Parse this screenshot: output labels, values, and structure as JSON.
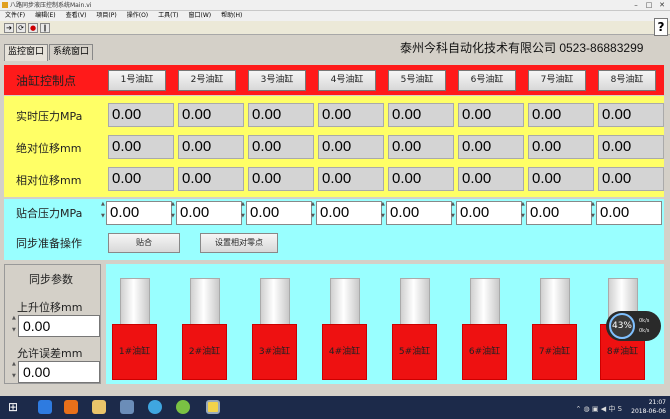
{
  "window": {
    "title": "八路同步液压控制系统Main.vi"
  },
  "menu": [
    "文件(F)",
    "编辑(E)",
    "查看(V)",
    "项目(P)",
    "操作(O)",
    "工具(T)",
    "窗口(W)",
    "帮助(H)"
  ],
  "tabs": [
    {
      "label": "监控窗口",
      "active": true
    },
    {
      "label": "系统窗口",
      "active": false
    }
  ],
  "company": "泰州今科自动化技术有限公司 0523-86883299",
  "control": {
    "label": "油缸控制点",
    "buttons": [
      "1号油缸",
      "2号油缸",
      "3号油缸",
      "4号油缸",
      "5号油缸",
      "6号油缸",
      "7号油缸",
      "8号油缸"
    ]
  },
  "rows": [
    {
      "label": "实时压力MPa",
      "values": [
        "0.00",
        "0.00",
        "0.00",
        "0.00",
        "0.00",
        "0.00",
        "0.00",
        "0.00"
      ]
    },
    {
      "label": "绝对位移mm",
      "values": [
        "0.00",
        "0.00",
        "0.00",
        "0.00",
        "0.00",
        "0.00",
        "0.00",
        "0.00"
      ]
    },
    {
      "label": "相对位移mm",
      "values": [
        "0.00",
        "0.00",
        "0.00",
        "0.00",
        "0.00",
        "0.00",
        "0.00",
        "0.00"
      ]
    }
  ],
  "fit_pressure": {
    "label": "贴合压力MPa",
    "values": [
      "0.00",
      "0.00",
      "0.00",
      "0.00",
      "0.00",
      "0.00",
      "0.00",
      "0.00"
    ]
  },
  "sync_prep": {
    "label": "同步准备操作",
    "fit_button": "贴合",
    "zero_button": "设置相对零点"
  },
  "sync_params": {
    "title": "同步参数",
    "rise_label": "上升位移mm",
    "rise_value": "0.00",
    "tolerance_label": "允许误差mm",
    "tolerance_value": "0.00"
  },
  "cylinders": [
    "1#油缸",
    "2#油缸",
    "3#油缸",
    "4#油缸",
    "5#油缸",
    "6#油缸",
    "7#油缸",
    "8#油缸"
  ],
  "gauge": {
    "value": "43%",
    "line1": "0k/s",
    "line2": "0k/s"
  },
  "clock": {
    "time": "21:07",
    "date": "2018-06-06"
  },
  "colors": {
    "red_band": "#ff1a1a",
    "yellow_band": "#ffff66",
    "cyan_band": "#99ffff",
    "cylinder_body": "#ee1111"
  }
}
